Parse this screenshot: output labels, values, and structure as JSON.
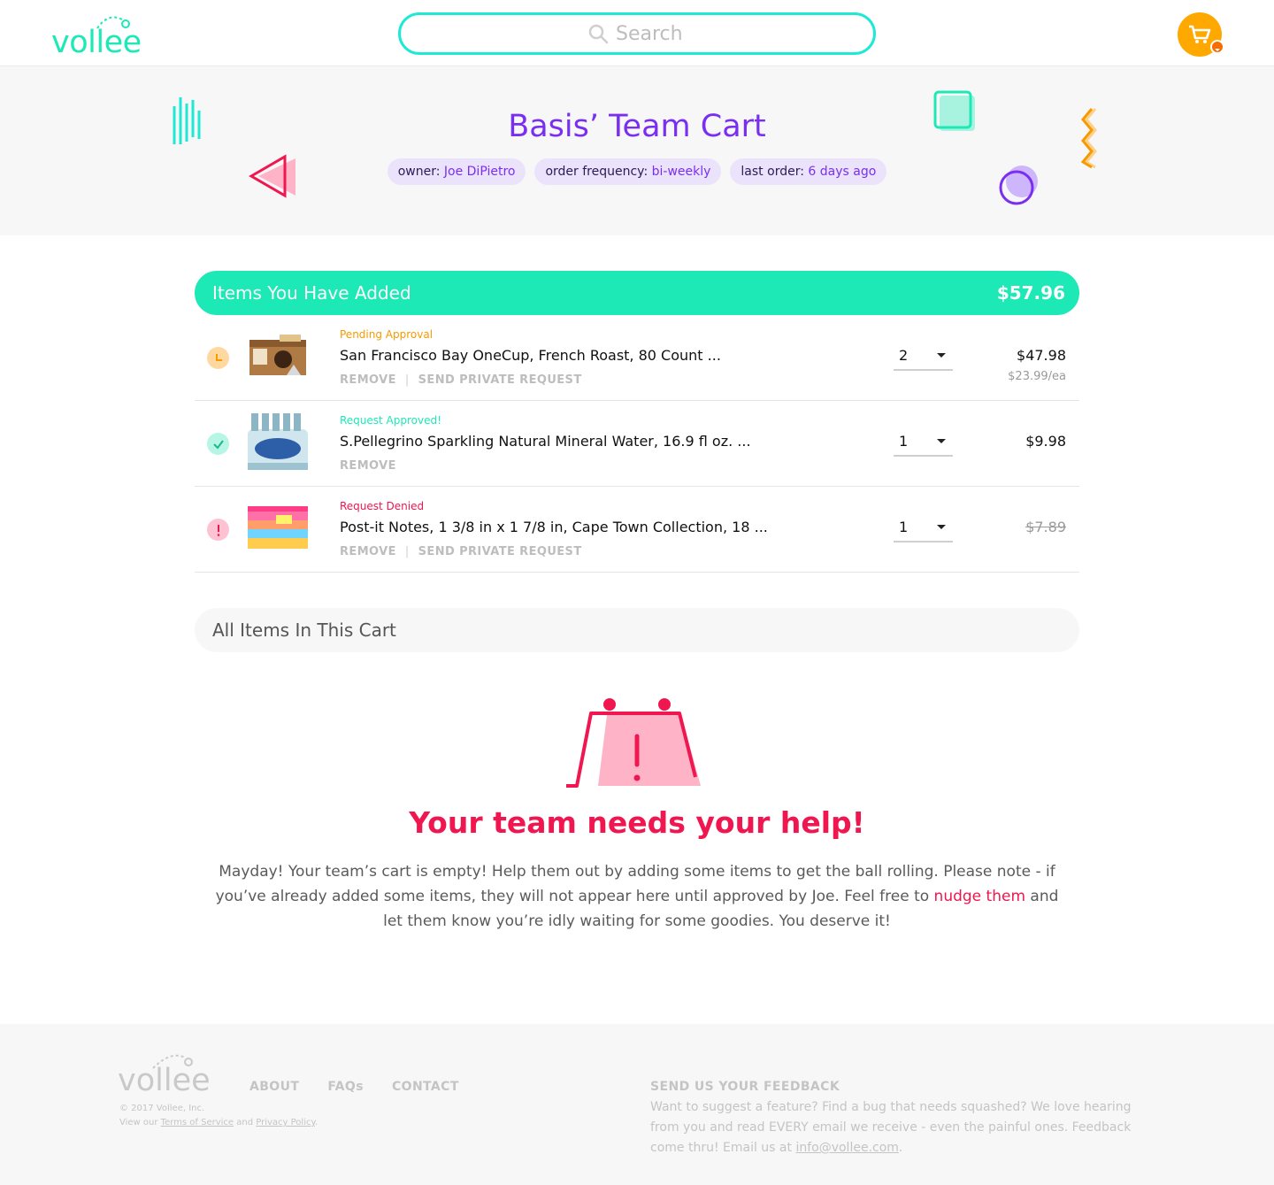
{
  "header": {
    "logo": "vollee",
    "search_placeholder": "Search"
  },
  "hero": {
    "title": "Basis’ Team Cart",
    "chips": [
      {
        "label": "owner:",
        "value": "Joe DiPietro"
      },
      {
        "label": "order frequency:",
        "value": "bi-weekly"
      },
      {
        "label": "last order:",
        "value": "6 days ago"
      }
    ]
  },
  "added": {
    "title": "Items You Have Added",
    "total": "$57.96",
    "items": [
      {
        "status": "Pending Approval",
        "name": "San Francisco Bay OneCup, French Roast, 80 Count ...",
        "remove": "REMOVE",
        "sep": "|",
        "request": "SEND PRIVATE REQUEST",
        "qty": "2",
        "price": "$47.98",
        "unit": "$23.99/ea"
      },
      {
        "status": "Request Approved!",
        "name": "S.Pellegrino Sparkling Natural Mineral Water, 16.9 fl oz. ...",
        "remove": "REMOVE",
        "qty": "1",
        "price": "$9.98"
      },
      {
        "status": "Request Denied",
        "name": "Post-it Notes, 1 3/8 in x 1 7/8 in, Cape Town Collection, 18 ...",
        "remove": "REMOVE",
        "sep": "|",
        "request": "SEND PRIVATE REQUEST",
        "qty": "1",
        "price": "$7.89"
      }
    ]
  },
  "all_items": {
    "title": "All Items In This Cart"
  },
  "empty": {
    "title": "Your team needs your help!",
    "text_before": "Mayday! Your team’s cart is empty! Help them out by adding some items to get the ball rolling. Please note - if you’ve already added some items, they will not appear here until approved by Joe. Feel free to ",
    "link": "nudge them",
    "text_after": " and let them know you’re idly waiting for some goodies. You deserve it!"
  },
  "footer": {
    "logo": "vollee",
    "copyright": "© 2017 Vollee, Inc.",
    "view_our": "View our ",
    "terms": "Terms of Service",
    "and": " and ",
    "privacy": "Privacy Policy",
    "period": ".",
    "nav": [
      "ABOUT",
      "FAQs",
      "CONTACT"
    ],
    "feedback_title": "SEND US YOUR FEEDBACK",
    "feedback_text": "Want to suggest a feature? Find a bug that needs squashed? We love hearing from you and read EVERY email we receive - even the painful ones. Feedback come thru! Email us at ",
    "email": "info@vollee.com",
    "feedback_end": "."
  },
  "colors": {
    "brand": "#1de9b6",
    "accent_purple": "#7a2ff0",
    "pending": "#f59a00",
    "approved": "#1de9b6",
    "denied": "#f0164f"
  },
  "icons": [
    "search-icon",
    "cart-icon",
    "clock-icon",
    "check-icon",
    "alert-icon",
    "empty-cart-icon"
  ]
}
